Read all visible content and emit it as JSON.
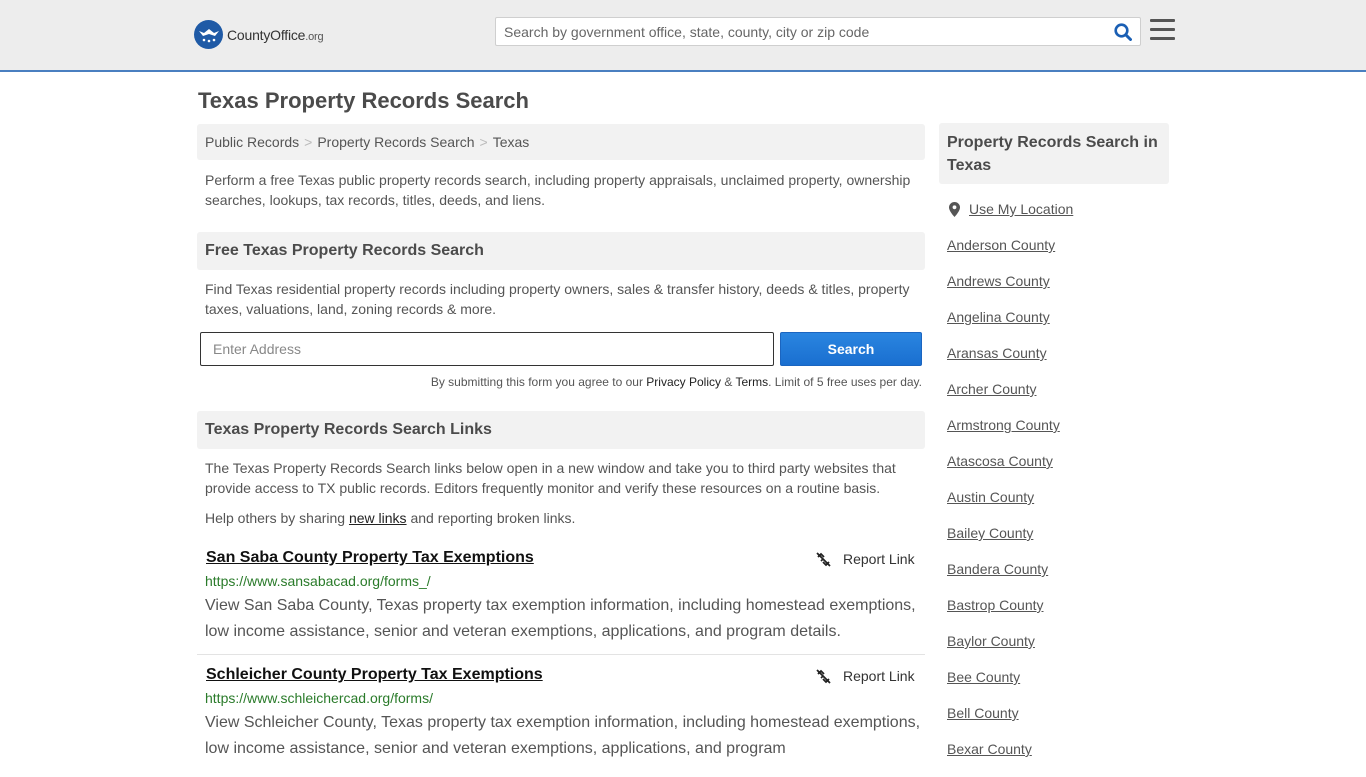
{
  "header": {
    "logo_main": "CountyOffice",
    "logo_tld": ".org",
    "search_placeholder": "Search by government office, state, county, city or zip code"
  },
  "page": {
    "title": "Texas Property Records Search",
    "breadcrumb": [
      "Public Records",
      "Property Records Search",
      "Texas"
    ],
    "intro": "Perform a free Texas public property records search, including property appraisals, unclaimed property, ownership searches, lookups, tax records, titles, deeds, and liens."
  },
  "free_search": {
    "heading": "Free Texas Property Records Search",
    "description": "Find Texas residential property records including property owners, sales & transfer history, deeds & titles, property taxes, valuations, land, zoning records & more.",
    "address_placeholder": "Enter Address",
    "button_label": "Search",
    "terms_prefix": "By submitting this form you agree to our",
    "privacy_label": "Privacy Policy",
    "terms_amp": "&",
    "terms_label": "Terms",
    "terms_suffix": ". Limit of 5 free uses per day."
  },
  "links_section": {
    "heading": "Texas Property Records Search Links",
    "description": "The Texas Property Records Search links below open in a new window and take you to third party websites that provide access to TX public records. Editors frequently monitor and verify these resources on a routine basis.",
    "help_prefix": "Help others by sharing",
    "help_link": "new links",
    "help_suffix": "and reporting broken links.",
    "report_label": "Report Link",
    "items": [
      {
        "title": "San Saba County Property Tax Exemptions",
        "url": "https://www.sansabacad.org/forms_/",
        "description": "View San Saba County, Texas property tax exemption information, including homestead exemptions, low income assistance, senior and veteran exemptions, applications, and program details."
      },
      {
        "title": "Schleicher County Property Tax Exemptions",
        "url": "https://www.schleichercad.org/forms/",
        "description": "View Schleicher County, Texas property tax exemption information, including homestead exemptions, low income assistance, senior and veteran exemptions, applications, and program"
      }
    ]
  },
  "sidebar": {
    "heading": "Property Records Search in Texas",
    "use_location": "Use My Location",
    "counties": [
      "Anderson County",
      "Andrews County",
      "Angelina County",
      "Aransas County",
      "Archer County",
      "Armstrong County",
      "Atascosa County",
      "Austin County",
      "Bailey County",
      "Bandera County",
      "Bastrop County",
      "Baylor County",
      "Bee County",
      "Bell County",
      "Bexar County"
    ]
  },
  "icons": {
    "logo": "eagle-star-badge-icon",
    "search": "magnifier-icon",
    "menu": "hamburger-icon",
    "report": "broken-link-icon",
    "location": "map-pin-icon"
  },
  "colors": {
    "header_bg": "#ededed",
    "accent": "#1f6fd0",
    "url_green": "#2a7b2a",
    "panel_bg": "#f2f2f2"
  }
}
